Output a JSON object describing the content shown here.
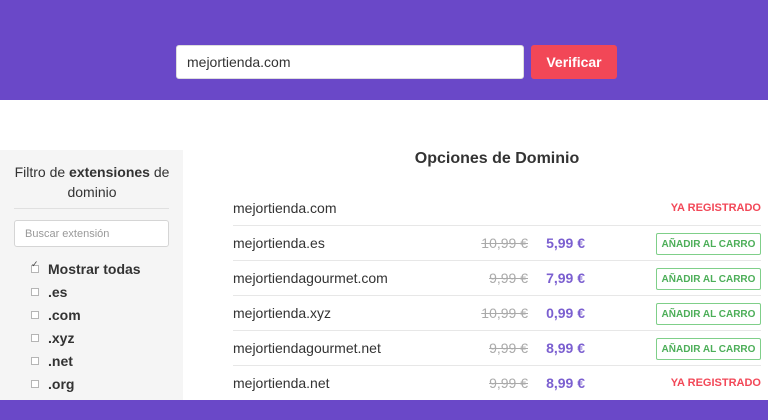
{
  "header": {
    "search_value": "mejortienda.com",
    "verify_label": "Verificar"
  },
  "sidebar": {
    "title_pre": "Filtro de ",
    "title_bold": "extensiones",
    "title_post": " de dominio",
    "search_placeholder": "Buscar extensión",
    "options": [
      {
        "label": "Mostrar todas",
        "checked": true
      },
      {
        "label": ".es",
        "checked": false
      },
      {
        "label": ".com",
        "checked": false
      },
      {
        "label": ".xyz",
        "checked": false
      },
      {
        "label": ".net",
        "checked": false
      },
      {
        "label": ".org",
        "checked": false
      }
    ]
  },
  "main": {
    "title": "Opciones de Dominio",
    "rows": [
      {
        "domain": "mejortienda.com",
        "old_price": "",
        "new_price": "",
        "status": "YA REGISTRADO",
        "action": ""
      },
      {
        "domain": "mejortienda.es",
        "old_price": "10,99 €",
        "new_price": "5,99 €",
        "status": "",
        "action": "AÑADIR AL CARRO"
      },
      {
        "domain": "mejortiendagourmet.com",
        "old_price": "9,99 €",
        "new_price": "7,99 €",
        "status": "",
        "action": "AÑADIR AL CARRO"
      },
      {
        "domain": "mejortienda.xyz",
        "old_price": "10,99 €",
        "new_price": "0,99 €",
        "status": "",
        "action": "AÑADIR AL CARRO"
      },
      {
        "domain": "mejortiendagourmet.net",
        "old_price": "9,99 €",
        "new_price": "8,99 €",
        "status": "",
        "action": "AÑADIR AL CARRO"
      },
      {
        "domain": "mejortienda.net",
        "old_price": "9,99 €",
        "new_price": "8,99 €",
        "status": "YA REGISTRADO",
        "action": ""
      }
    ]
  },
  "colors": {
    "brand_purple": "#6a48c8",
    "accent_red": "#f24757",
    "price_purple": "#7b5fd0",
    "cart_green": "#4cae58"
  }
}
